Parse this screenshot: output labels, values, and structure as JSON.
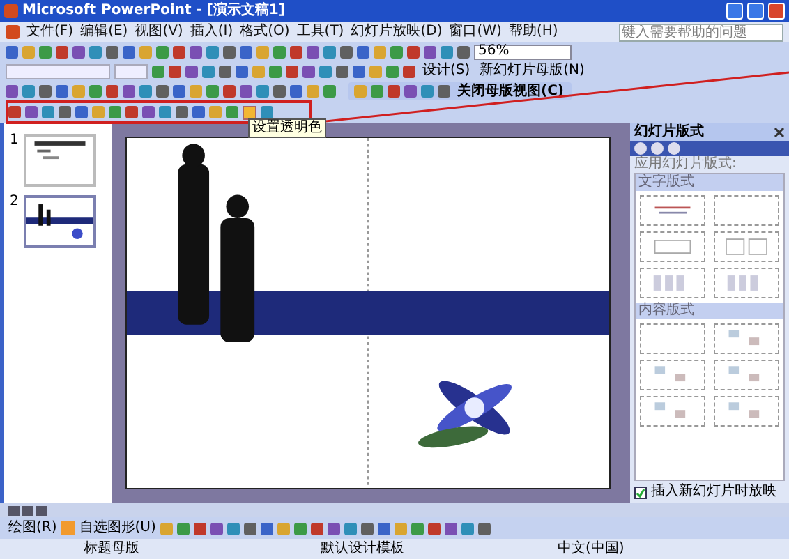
{
  "window": {
    "title": "Microsoft PowerPoint - [演示文稿1]"
  },
  "menu": [
    "文件(F)",
    "编辑(E)",
    "视图(V)",
    "插入(I)",
    "格式(O)",
    "工具(T)",
    "幻灯片放映(D)",
    "窗口(W)",
    "帮助(H)"
  ],
  "help_search": {
    "placeholder": "键入需要帮助的问题"
  },
  "standard_toolbar": {
    "zoom": "56%"
  },
  "formatting_toolbar": {
    "buttons": [
      "设计(S)",
      "新幻灯片母版(N)"
    ]
  },
  "master_toolbar": {
    "button": "关闭母版视图(C)"
  },
  "picture_toolbar": {
    "tooltip": "设置透明色"
  },
  "thumbnails": [
    {
      "number": "1",
      "kind": "title",
      "selected": false
    },
    {
      "number": "2",
      "kind": "figures",
      "selected": true
    }
  ],
  "task_pane": {
    "title": "幻灯片版式",
    "apply_label": "应用幻灯片版式:",
    "sections": [
      {
        "title": "文字版式",
        "layouts": [
          {
            "kind": "title"
          },
          {
            "kind": "blank"
          },
          {
            "kind": "text"
          },
          {
            "kind": "two-column"
          },
          {
            "kind": "columns"
          },
          {
            "kind": "columns"
          }
        ]
      },
      {
        "title": "内容版式",
        "layouts": [
          {
            "kind": "blank"
          },
          {
            "kind": "content"
          },
          {
            "kind": "content"
          },
          {
            "kind": "content"
          },
          {
            "kind": "content"
          },
          {
            "kind": "content"
          }
        ]
      }
    ]
  },
  "insert_checkbox": {
    "label": "插入新幻灯片时放映",
    "checked": true
  },
  "drawing_toolbar": {
    "draw_menu": "绘图(R)",
    "autoshapes": "自选图形(U)"
  },
  "status_bar": [
    "标题母版",
    "默认设计模板",
    "中文(中国)"
  ]
}
